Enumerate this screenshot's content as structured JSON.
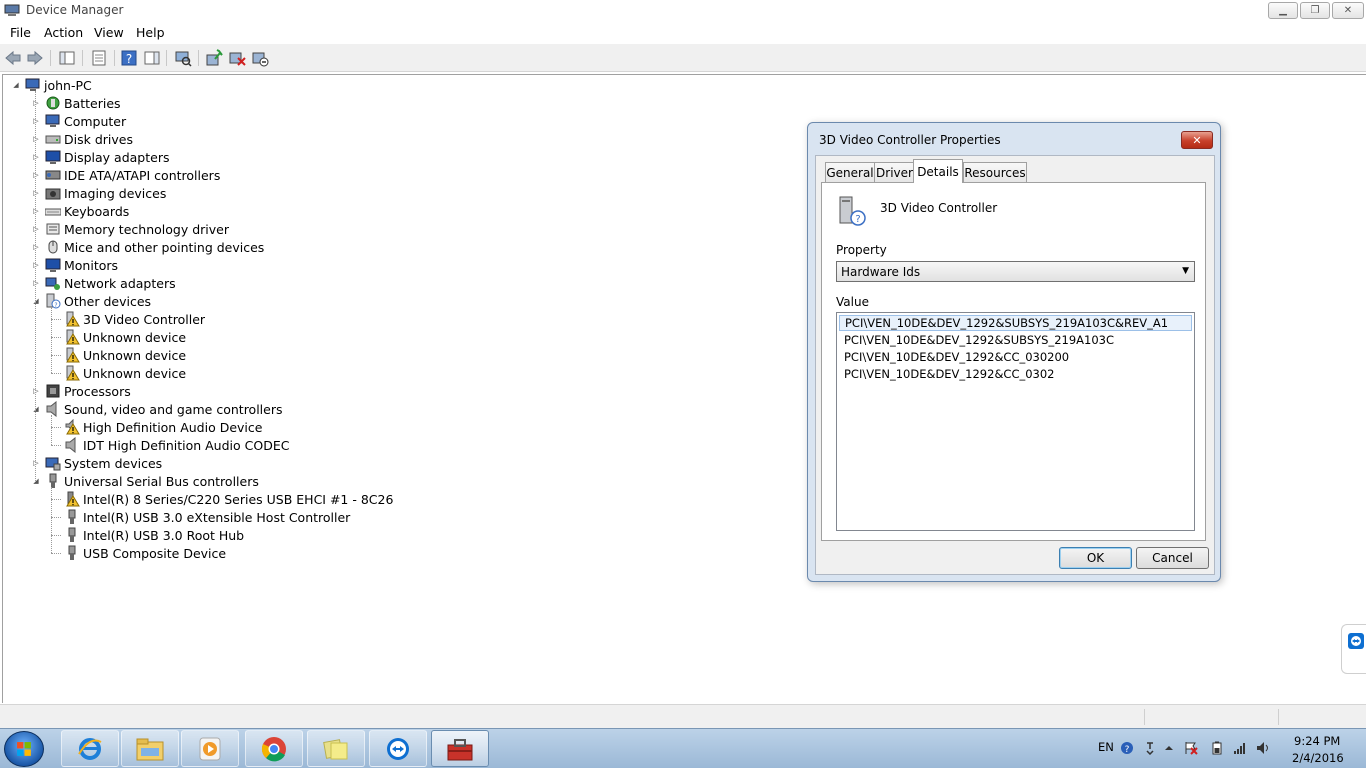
{
  "window": {
    "title": "Device Manager",
    "icon": "device-manager-icon",
    "controls": [
      "minimize-icon",
      "maximize-icon",
      "close-icon"
    ]
  },
  "menu": {
    "items": [
      {
        "label": "File"
      },
      {
        "label": "Action"
      },
      {
        "label": "View"
      },
      {
        "label": "Help"
      }
    ]
  },
  "toolbar": {
    "icons": [
      "back-arrow-icon",
      "forward-arrow-icon",
      "show-hide-tree-icon",
      "properties-icon",
      "help-icon",
      "action-pane-icon",
      "scan-hardware-icon",
      "update-driver-icon",
      "uninstall-icon",
      "disable-icon"
    ]
  },
  "tree": {
    "root": "john-PC",
    "categories": [
      {
        "label": "Batteries",
        "icon": "battery-icon",
        "expanded": false
      },
      {
        "label": "Computer",
        "icon": "computer-icon",
        "expanded": false
      },
      {
        "label": "Disk drives",
        "icon": "disk-drive-icon",
        "expanded": false
      },
      {
        "label": "Display adapters",
        "icon": "display-adapter-icon",
        "expanded": false
      },
      {
        "label": "IDE ATA/ATAPI controllers",
        "icon": "ide-controller-icon",
        "expanded": false
      },
      {
        "label": "Imaging devices",
        "icon": "camera-icon",
        "expanded": false
      },
      {
        "label": "Keyboards",
        "icon": "keyboard-icon",
        "expanded": false
      },
      {
        "label": "Memory technology driver",
        "icon": "memory-icon",
        "expanded": false
      },
      {
        "label": "Mice and other pointing devices",
        "icon": "mouse-icon",
        "expanded": false
      },
      {
        "label": "Monitors",
        "icon": "monitor-icon",
        "expanded": false
      },
      {
        "label": "Network adapters",
        "icon": "network-adapter-icon",
        "expanded": false
      },
      {
        "label": "Other devices",
        "icon": "unknown-device-icon",
        "expanded": true,
        "children": [
          {
            "label": "3D Video Controller",
            "icon": "warning-device-icon"
          },
          {
            "label": "Unknown device",
            "icon": "warning-device-icon"
          },
          {
            "label": "Unknown device",
            "icon": "warning-device-icon"
          },
          {
            "label": "Unknown device",
            "icon": "warning-device-icon"
          }
        ]
      },
      {
        "label": "Processors",
        "icon": "processor-icon",
        "expanded": false
      },
      {
        "label": "Sound, video and game controllers",
        "icon": "speaker-icon",
        "expanded": true,
        "children": [
          {
            "label": "High Definition Audio Device",
            "icon": "warning-speaker-icon"
          },
          {
            "label": "IDT High Definition Audio CODEC",
            "icon": "speaker-icon"
          }
        ]
      },
      {
        "label": "System devices",
        "icon": "system-device-icon",
        "expanded": false
      },
      {
        "label": "Universal Serial Bus controllers",
        "icon": "usb-icon",
        "expanded": true,
        "children": [
          {
            "label": "Intel(R) 8 Series/C220 Series USB EHCI #1 - 8C26",
            "icon": "warning-usb-icon"
          },
          {
            "label": "Intel(R) USB 3.0 eXtensible Host Controller",
            "icon": "usb-icon"
          },
          {
            "label": "Intel(R) USB 3.0 Root Hub",
            "icon": "usb-icon"
          },
          {
            "label": "USB Composite Device",
            "icon": "usb-icon"
          }
        ]
      }
    ]
  },
  "dialog": {
    "title": "3D Video Controller Properties",
    "tabs": [
      {
        "label": "General"
      },
      {
        "label": "Driver"
      },
      {
        "label": "Details",
        "active": true
      },
      {
        "label": "Resources"
      }
    ],
    "device_name": "3D Video Controller",
    "property_label": "Property",
    "property_value": "Hardware Ids",
    "value_label": "Value",
    "values": [
      "PCI\\VEN_10DE&DEV_1292&SUBSYS_219A103C&REV_A1",
      "PCI\\VEN_10DE&DEV_1292&SUBSYS_219A103C",
      "PCI\\VEN_10DE&DEV_1292&CC_030200",
      "PCI\\VEN_10DE&DEV_1292&CC_0302"
    ],
    "ok_label": "OK",
    "cancel_label": "Cancel"
  },
  "taskbar": {
    "apps": [
      {
        "name": "internet-explorer-icon"
      },
      {
        "name": "file-explorer-icon"
      },
      {
        "name": "media-player-icon"
      },
      {
        "name": "chrome-icon"
      },
      {
        "name": "sticky-notes-icon"
      },
      {
        "name": "teamviewer-icon"
      },
      {
        "name": "toolbox-icon",
        "active": true
      }
    ],
    "language": "EN",
    "time": "9:24 PM",
    "date": "2/4/2016"
  },
  "colors": {
    "warning": "#f2c230",
    "selection": "#e8f1fb",
    "dialog_frame": "#d9e4f1"
  }
}
